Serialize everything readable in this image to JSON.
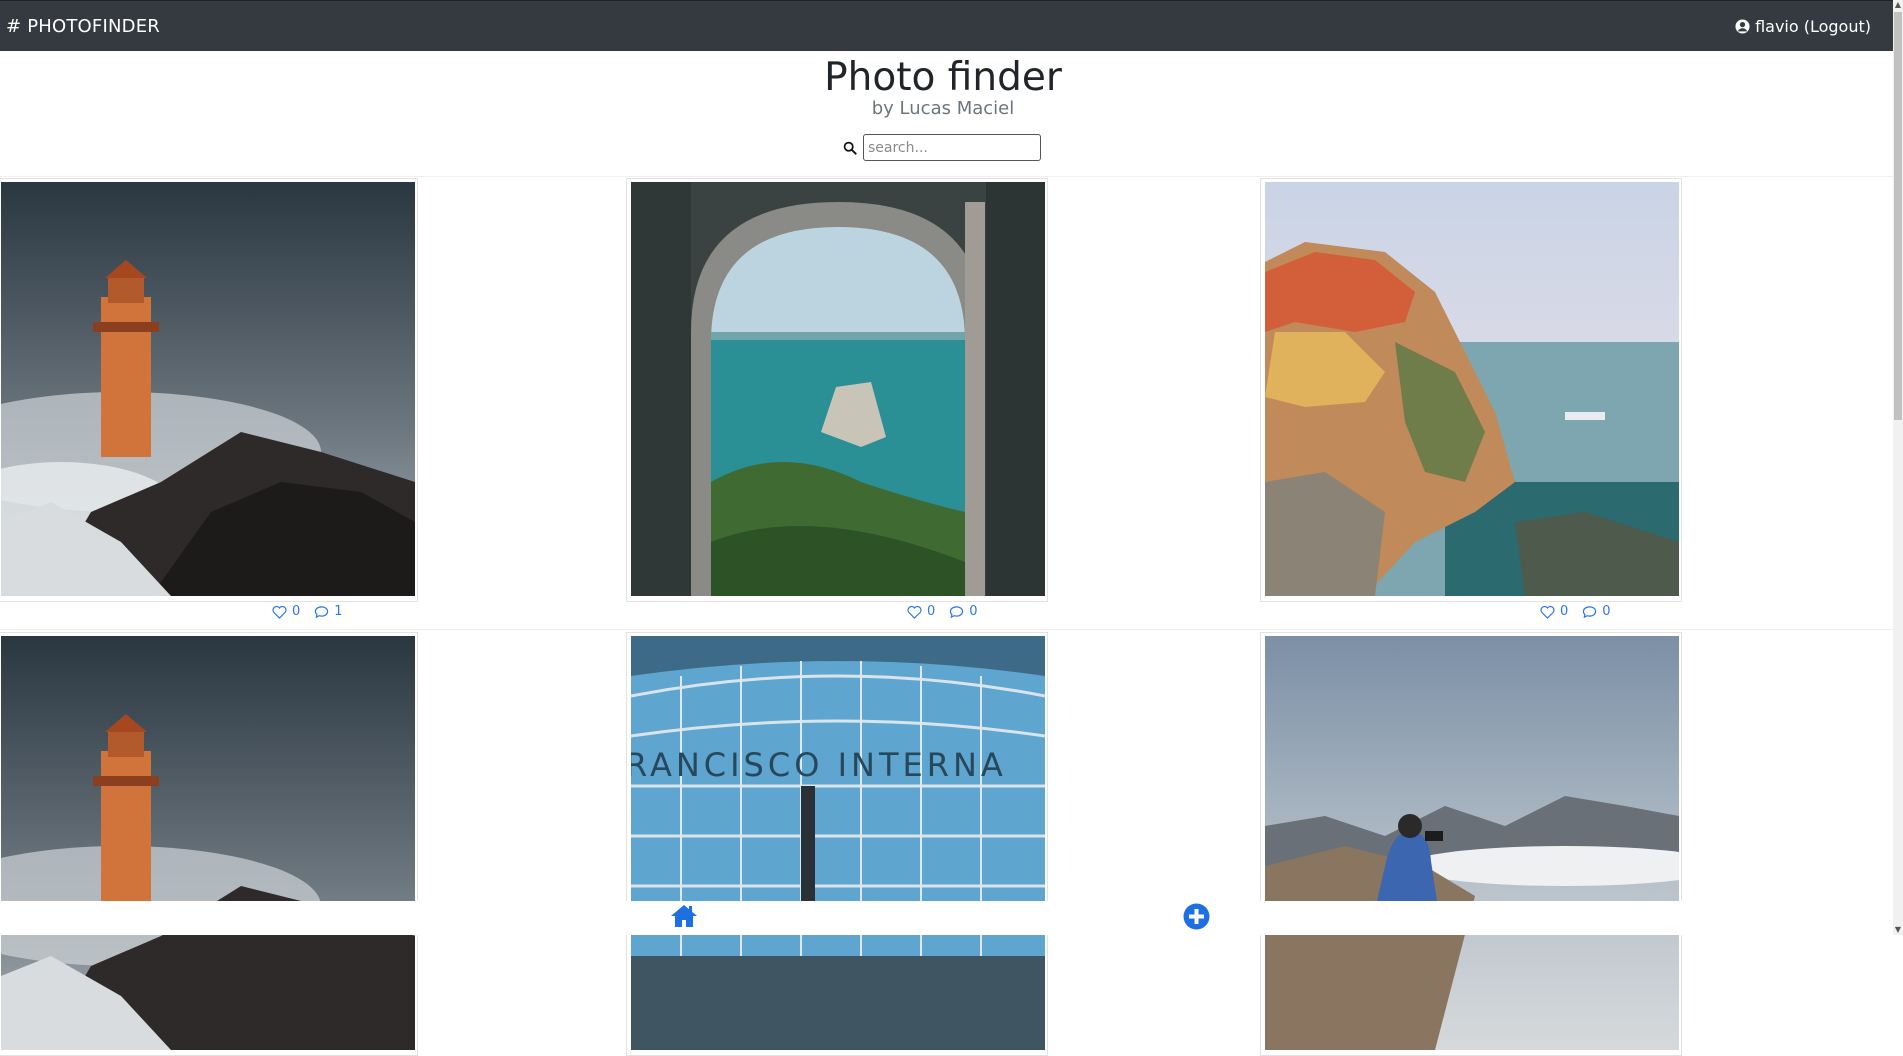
{
  "navbar": {
    "brand": "# PHOTOFINDER",
    "user_label": "flavio (Logout)"
  },
  "header": {
    "title": "Photo finder",
    "subtitle": "by Lucas Maciel"
  },
  "search": {
    "placeholder": "search..."
  },
  "photos": [
    {
      "subject": "lighthouse storm waves",
      "likes": "0",
      "comments": "1"
    },
    {
      "subject": "arched window sea view",
      "likes": "0",
      "comments": "0"
    },
    {
      "subject": "cliffside colorful village",
      "likes": "0",
      "comments": "0"
    },
    {
      "subject": "lighthouse storm waves",
      "likes": "",
      "comments": ""
    },
    {
      "subject": "airport glass facade",
      "likes": "",
      "comments": ""
    },
    {
      "subject": "photographer on mountain",
      "likes": "",
      "comments": ""
    }
  ],
  "airport_sign": "RANCISCO INTERNA",
  "icons": {
    "like": "heart-icon",
    "comment": "comment-icon",
    "search": "search-icon",
    "user": "user-circle-icon",
    "home": "home-icon",
    "add": "plus-circle-icon"
  },
  "colors": {
    "navbar": "#343a40",
    "accent": "#2b78e4",
    "add_button": "#1e6fe0"
  }
}
